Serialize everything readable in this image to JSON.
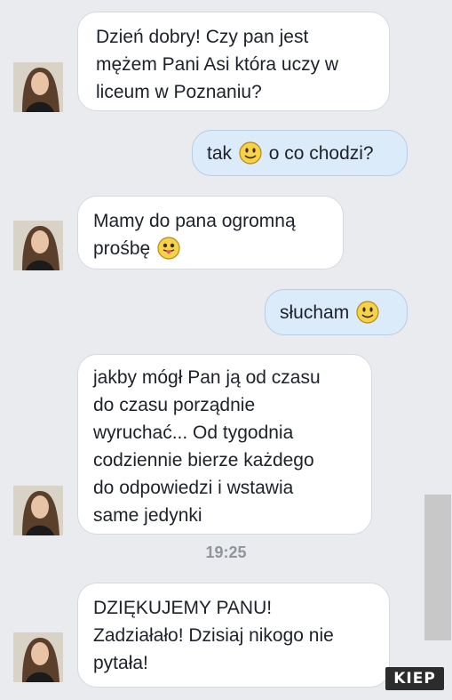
{
  "messages": [
    {
      "sender": "contact",
      "lines": [
        "Dzień dobry! Czy pan jest",
        "mężem Pani Asi która uczy w",
        "liceum w Poznaniu?"
      ]
    },
    {
      "sender": "me",
      "before": "tak",
      "after": "o co chodzi?",
      "emoji": "smile-emoji"
    },
    {
      "sender": "contact",
      "line1": "Mamy do pana ogromną",
      "line2": "prośbę",
      "emoji": "tongue-emoji"
    },
    {
      "sender": "me",
      "text": "słucham",
      "emoji": "smile-emoji"
    },
    {
      "sender": "contact",
      "lines": [
        "jakby mógł Pan ją od czasu",
        "do czasu porządnie",
        "wyruchać... Od tygodnia",
        "codziennie bierze każdego",
        "do odpowiedzi i wstawia",
        "same jedynki"
      ]
    },
    {
      "sender": "contact",
      "lines": [
        "DZIĘKUJEMY PANU!",
        "Zadziałało! Dzisiaj nikogo nie",
        "pytała!"
      ]
    }
  ],
  "timestamp": "19:25",
  "watermark": "KIEP",
  "colors": {
    "incoming": "#ffffff",
    "outgoing": "#dcebfa",
    "background": "#e9ebee"
  }
}
